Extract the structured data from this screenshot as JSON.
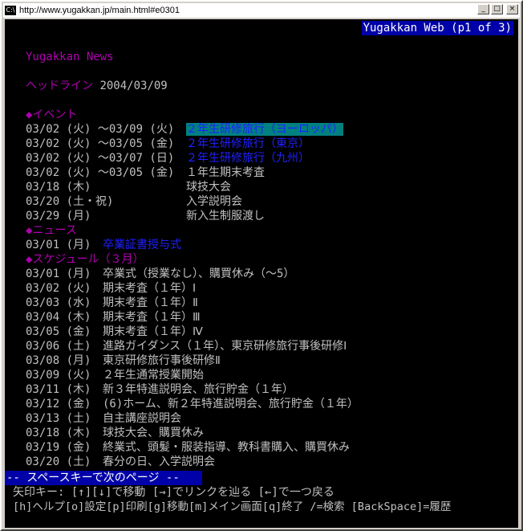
{
  "window": {
    "icon": "C:\\",
    "title": "http://www.yugakkan.jp/main.html#e0301",
    "buttons": {
      "minimize": "_",
      "maximize": "□",
      "close": "×"
    }
  },
  "pager_status": "Yugakkan Web (p1 of 3)",
  "header": {
    "site_title": "Yugakkan News",
    "headline_label": "ヘッドライン",
    "headline_date": "2004/03/09"
  },
  "events": {
    "heading": "◆イベント",
    "items": [
      {
        "date": "03/02 (火) ～03/09 (火)",
        "title": "２年生研修旅行（ヨーロッパ）"
      },
      {
        "date": "03/02 (火) ～03/05 (金)",
        "title": "２年生研修旅行（東京）"
      },
      {
        "date": "03/02 (火) ～03/07 (日)",
        "title": "２年生研修旅行（九州）"
      },
      {
        "date": "03/02 (火) ～03/05 (金)",
        "title": "１年生期末考査"
      },
      {
        "date": "03/18 (木)",
        "title": "球技大会"
      },
      {
        "date": "03/20 (土・祝)",
        "title": "入学説明会"
      },
      {
        "date": "03/29 (月)",
        "title": "新入生制服渡し"
      }
    ]
  },
  "news": {
    "heading": "◆ニュース",
    "items": [
      {
        "date": "03/01 (月)",
        "title": "卒業証書授与式"
      }
    ]
  },
  "schedule": {
    "heading": "◆スケジュール（３月）",
    "items": [
      {
        "date": "03/01 (月)",
        "text": "卒業式（授業なし）、購買休み（～5）"
      },
      {
        "date": "03/02 (火)",
        "text": "期末考査（１年）Ⅰ"
      },
      {
        "date": "03/03 (水)",
        "text": "期末考査（１年）Ⅱ"
      },
      {
        "date": "03/04 (木)",
        "text": "期末考査（１年）Ⅲ"
      },
      {
        "date": "03/05 (金)",
        "text": "期末考査（１年）Ⅳ"
      },
      {
        "date": "03/06 (土)",
        "text": "進路ガイダンス（１年）、東京研修旅行事後研修Ⅰ"
      },
      {
        "date": "03/08 (月)",
        "text": "東京研修旅行事後研修Ⅱ"
      },
      {
        "date": "03/09 (火)",
        "text": "２年生通常授業開始"
      },
      {
        "date": "03/11 (木)",
        "text": "新３年特進説明会、旅行貯金（１年）"
      },
      {
        "date": "03/12 (金)",
        "text": "(6)ホーム、新２年特進説明会、旅行貯金（１年）"
      },
      {
        "date": "03/13 (土)",
        "text": "自主講座説明会"
      },
      {
        "date": "03/18 (木)",
        "text": "球技大会、購買休み"
      },
      {
        "date": "03/19 (金)",
        "text": "終業式、頭髪・服装指導、教科書購入、購買休み"
      },
      {
        "date": "03/20 (土)",
        "text": "春分の日、入学説明会"
      }
    ]
  },
  "footer": {
    "next_page": "-- スペースキーで次のページ --",
    "help_line1": "矢印キー: [↑][↓]で移動 [→]でリンクを辿る [←]で一つ戻る",
    "help_line2": "[h]ヘルプ[o]設定[p]印刷[g]移動[m]メイン画面[q]終了 /=検索 [BackSpace]=履歴"
  }
}
